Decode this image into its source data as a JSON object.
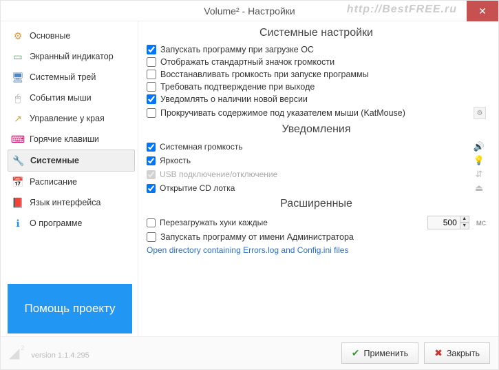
{
  "window": {
    "title": "Volume² - Настройки",
    "watermark": "http://BestFREE.ru"
  },
  "sidebar": {
    "items": [
      {
        "label": "Основные",
        "icon": "⚙",
        "color": "#e29b3d"
      },
      {
        "label": "Экранный индикатор",
        "icon": "▭",
        "color": "#3fae4a"
      },
      {
        "label": "Системный трей",
        "icon": "🖥",
        "color": "#4a88c7"
      },
      {
        "label": "События мыши",
        "icon": "🖱",
        "color": "#999"
      },
      {
        "label": "Управление у края",
        "icon": "↗",
        "color": "#e2a23d"
      },
      {
        "label": "Горячие клавиши",
        "icon": "⌨",
        "color": "#c06"
      },
      {
        "label": "Системные",
        "icon": "🔧",
        "color": "#777",
        "active": true
      },
      {
        "label": "Расписание",
        "icon": "📅",
        "color": "#3fae4a"
      },
      {
        "label": "Язык интерфейса",
        "icon": "📕",
        "color": "#c33"
      },
      {
        "label": "О программе",
        "icon": "ℹ",
        "color": "#2b8de0"
      }
    ],
    "promo": "Помощь проекту"
  },
  "sections": {
    "system": {
      "title": "Системные настройки",
      "opts": [
        {
          "label": "Запускать программу при загрузке ОС",
          "checked": true
        },
        {
          "label": "Отображать стандартный значок громкости",
          "checked": false
        },
        {
          "label": "Восстанавливать громкость при запуске программы",
          "checked": false
        },
        {
          "label": "Требовать подтверждение при выходе",
          "checked": false
        },
        {
          "label": "Уведомлять о наличии новой версии",
          "checked": true
        },
        {
          "label": "Прокручивать содержимое под указателем мыши (KatMouse)",
          "checked": false,
          "extra": true
        }
      ]
    },
    "notif": {
      "title": "Уведомления",
      "opts": [
        {
          "label": "Системная громкость",
          "checked": true,
          "icon": "🔊"
        },
        {
          "label": "Яркость",
          "checked": true,
          "icon": "💡"
        },
        {
          "label": "USB подключение/отключение",
          "checked": true,
          "disabled": true,
          "icon": "⇵"
        },
        {
          "label": "Открытие CD лотка",
          "checked": true,
          "icon": "⏏"
        }
      ]
    },
    "adv": {
      "title": "Расширенные",
      "reboot": {
        "label": "Перезагружать хуки каждые",
        "checked": false,
        "value": "500",
        "unit": "мс"
      },
      "admin": {
        "label": "Запускать программу от имени Администратора",
        "checked": false
      },
      "link": "Open directory containing Errors.log and Config.ini files"
    }
  },
  "footer": {
    "version": "version 1.1.4.295",
    "apply": "Применить",
    "close": "Закрыть"
  }
}
